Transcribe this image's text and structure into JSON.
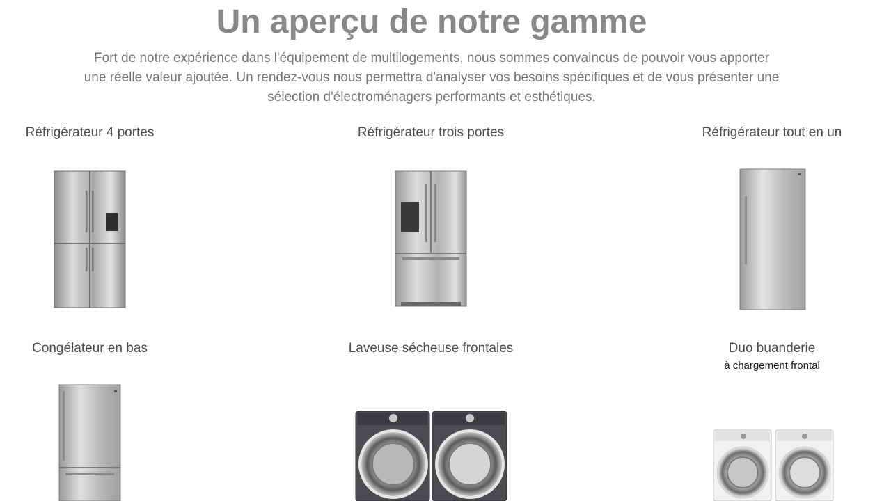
{
  "heading": "Un aperçu de notre gamme",
  "intro": {
    "line1": "Fort de notre expérience dans l'équipement de multilogements, nous sommes convaincus de pouvoir vous apporter",
    "line2": "une réelle valeur ajoutée. Un rendez-vous nous permettra d'analyser vos besoins spécifiques et de vous présenter une",
    "line3": "sélection d'électroménagers performants et esthétiques."
  },
  "products": [
    {
      "title": "Réfrigérateur 4 portes",
      "icon": "fridge-four-door-icon"
    },
    {
      "title": "Réfrigérateur trois portes",
      "icon": "fridge-three-door-icon"
    },
    {
      "title": "Réfrigérateur tout en un",
      "icon": "fridge-all-in-one-icon"
    },
    {
      "title": "Congélateur en bas",
      "icon": "fridge-bottom-freezer-icon"
    },
    {
      "title": "Laveuse sécheuse frontales",
      "icon": "washer-dryer-front-load-icon"
    },
    {
      "title": "Duo buanderie",
      "subtitle": "à chargement frontal",
      "icon": "laundry-duo-icon"
    }
  ],
  "colors": {
    "heading": "#888888",
    "text": "#767676",
    "product_title": "#4d4d4d",
    "steel": "#c9c9c9",
    "dark_appliance": "#4a4a4e",
    "white_appliance": "#f0f0f0"
  }
}
